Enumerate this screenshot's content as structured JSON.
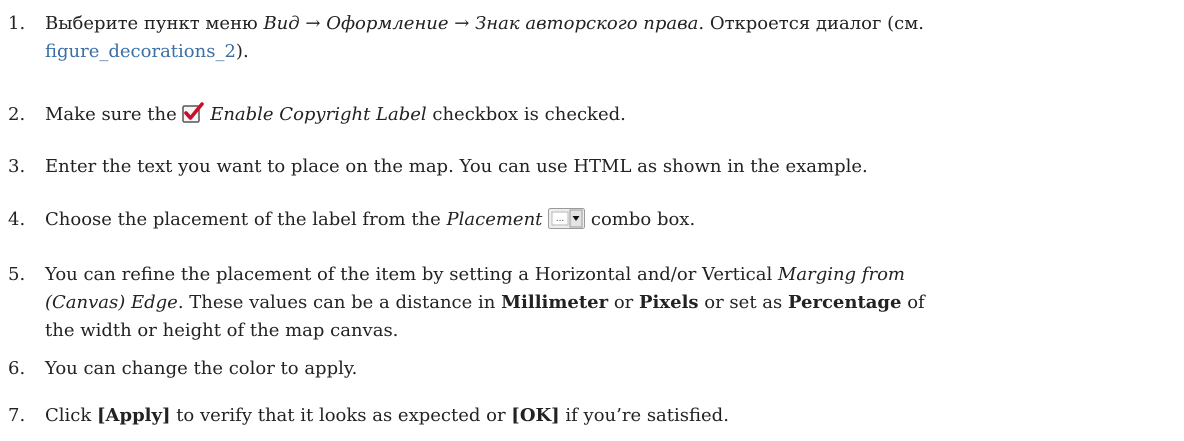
{
  "steps": [
    {
      "num": "1.",
      "t1": "Выберите пункт меню ",
      "menu_path": "Вид → Оформление → Знак авторского права",
      "t2": ". Откроется диалог (см.",
      "link": "figure_decorations_2",
      "t3": ")."
    },
    {
      "num": "2.",
      "t1": "Make sure the ",
      "label": "Enable Copyright Label",
      "t2": " checkbox is checked.",
      "icon": "checked-checkbox-icon"
    },
    {
      "num": "3.",
      "text": "Enter the text you want to place on the map. You can use HTML as shown in the example."
    },
    {
      "num": "4.",
      "t1": "Choose the placement of the label from the ",
      "label": "Placement",
      "t2": " combo box.",
      "icon": "combo-box-icon"
    },
    {
      "num": "5.",
      "t1": "You can refine the placement of the item by setting a Horizontal and/or Vertical ",
      "em1": "Marging from",
      "em2": "(Canvas) Edge",
      "t2": ". These values can be a distance in ",
      "b1": "Millimeter",
      "t3": " or ",
      "b2": "Pixels",
      "t4": " or set as ",
      "b3": "Percentage",
      "t5": " of",
      "t6": "the width or height of the map canvas."
    },
    {
      "num": "6.",
      "text": "You can change the color to apply."
    },
    {
      "num": "7.",
      "t1": "Click ",
      "b1": "[Apply]",
      "t2": " to verify that it looks as expected or ",
      "b2": "[OK]",
      "t3": " if you’re satisfied."
    }
  ]
}
